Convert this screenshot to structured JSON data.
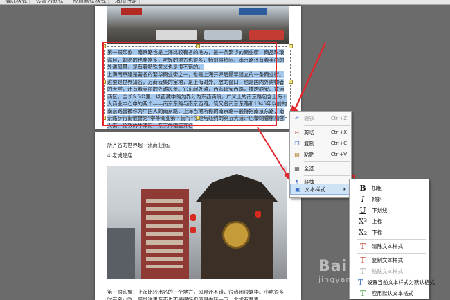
{
  "toolbar": {
    "items": [
      "清除格式",
      "设置为默认",
      "应用默认格式",
      "增加行距"
    ]
  },
  "page1": {
    "para1": "第一眼印象：南京路也是上海比较有名的地方，是一条繁华的商业街，商品琳琅满目，好吃的也非常多，吃饭的地方也很多，特别得热闹。南京路还有着美丽的外滩风景，是有着特殊意义也是很不错的。",
    "para2": "上海南京路是著名的繁华商业街之一，也是上海开埠后最早建立的一条商业街。这里是世界知名，万商云集的宝地，是上海对外开放的窗口，也是国内外购物者的天堂，还有着美丽的外滩风景。它东起外滩，西迄延安西路，横跨静安、黄浦两区，全长5.5公里，以西藏中路为界分为东西两段，广义上的南京路包含上海十大商业中心中的两个——南京东路与南京西路。筑又名南京东路和1945年以前的南京路曾被称为中国人的南京路，上海当地所称的南京路一般特指南京东路，南京路步行街被誉为“中华商业第一街”，它是与纽约的第五大道、巴黎的香榭丽舍大街、伦敦的牛津街，东京的银座齐名"
  },
  "page2": {
    "line1": "所齐名的世界超一流商业街。",
    "heading": "4.老城隍庙",
    "para": "第一眼印象：上海比较出名的一个地方，风景还不错，很热闹很繁华。小吃很多时有名小吃。感觉这里东西也不是很好但值得去转一下，非常有意思。"
  },
  "context_menu": {
    "items": [
      {
        "icon": "undo-icon",
        "label": "撤销",
        "shortcut": "Ctrl+Z",
        "disabled": true
      },
      {
        "icon": "cut-icon",
        "label": "剪切",
        "shortcut": "Ctrl+X"
      },
      {
        "icon": "copy-icon",
        "label": "复制",
        "shortcut": "Ctrl+C"
      },
      {
        "icon": "paste-icon",
        "label": "粘贴",
        "shortcut": "Ctrl+V"
      },
      {
        "icon": "select-all-icon",
        "label": "全选",
        "shortcut": ""
      },
      {
        "icon": "paragraph-icon",
        "label": "段落...",
        "shortcut": ""
      },
      {
        "icon": "text-style-icon",
        "label": "文本样式",
        "shortcut": ""
      }
    ]
  },
  "submenu": {
    "items": [
      {
        "icon": "bold-icon",
        "glyph": "B",
        "label": "加粗"
      },
      {
        "icon": "italic-icon",
        "glyph": "I",
        "label": "倾斜"
      },
      {
        "icon": "underline-icon",
        "glyph": "U",
        "label": "下划线"
      },
      {
        "icon": "superscript-icon",
        "glyph": "X²",
        "label": "上标"
      },
      {
        "icon": "subscript-icon",
        "glyph": "X₂",
        "label": "下标"
      },
      {
        "icon": "clear-style-icon",
        "glyph": "T",
        "label": "清除文本样式"
      },
      {
        "icon": "copy-style-icon",
        "glyph": "T",
        "label": "复制文本样式"
      },
      {
        "icon": "paste-style-icon",
        "glyph": "T",
        "label": "粘贴文本样式",
        "disabled": true
      },
      {
        "icon": "set-default-icon",
        "glyph": "T",
        "label": "设置当前文本样式为默认格式"
      },
      {
        "icon": "apply-default-icon",
        "glyph": "T",
        "label": "应用默认文本格式"
      }
    ]
  },
  "watermark": {
    "line1": "Bai",
    "line2": "jingyan"
  },
  "colors": {
    "annotation_red": "#e3262b",
    "selection_highlight": "#a5c9ee",
    "background": "#6b6b6b"
  }
}
